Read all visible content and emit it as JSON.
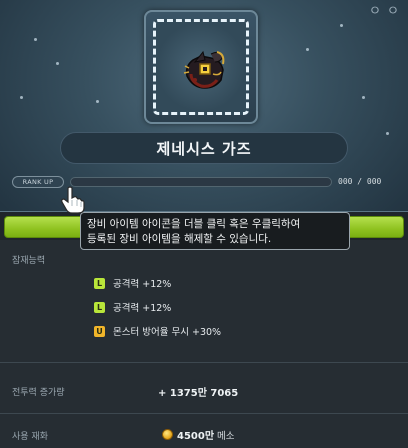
{
  "window": {
    "corner_glyph": "ㅇ ㅇ"
  },
  "item": {
    "name": "제네시스 가즈",
    "icon": "genesis-gauntlet-icon"
  },
  "rankup": {
    "button_label": "RANK UP",
    "progress_text": "000 / 000",
    "progress_fraction": 0
  },
  "tooltip": {
    "line1": "장비 아이템 아이콘을 더블 클릭 혹은 우클릭하여",
    "line2": "등록된 장비 아이템을 해제할 수 있습니다."
  },
  "potential": {
    "label": "잠재능력",
    "lines": [
      {
        "grade": "L",
        "text": "공격력 +12%"
      },
      {
        "grade": "L",
        "text": "공격력 +12%"
      },
      {
        "grade": "U",
        "text": "몬스터 방어율 무시 +30%"
      }
    ]
  },
  "combat_power": {
    "label": "전투력 증가량",
    "value": "+ 1375만 7065"
  },
  "cost": {
    "label": "사용 재화",
    "amount": "4500만",
    "unit": "메소"
  },
  "colors": {
    "accent_green": "#9fd13a",
    "legendary": "#b9e63a",
    "unique": "#f1b52a"
  }
}
